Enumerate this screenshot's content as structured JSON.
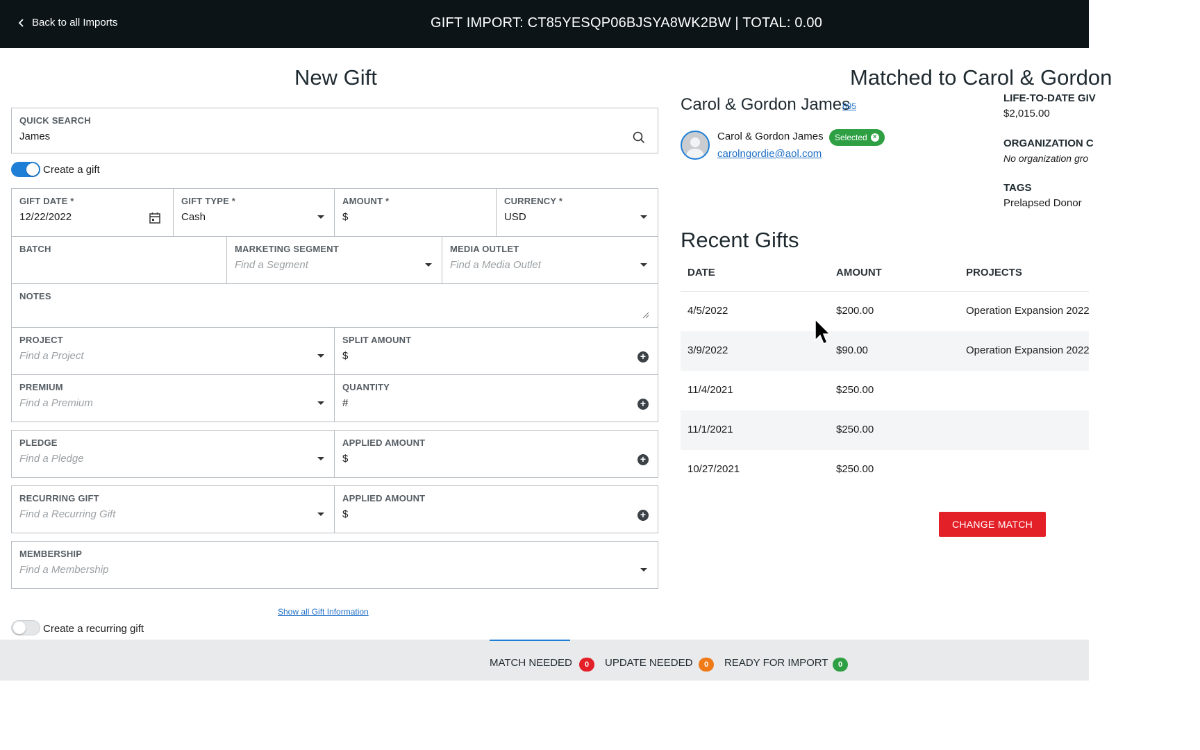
{
  "header": {
    "back_label": "Back to all Imports",
    "title": "GIFT IMPORT: CT85YESQP06BJSYA8WK2BW | TOTAL: 0.00"
  },
  "left": {
    "heading": "New Gift",
    "quick_search": {
      "label": "QUICK SEARCH",
      "value": "James"
    },
    "create_gift_toggle": "Create a gift",
    "gift_date": {
      "label": "GIFT DATE *",
      "value": "12/22/2022"
    },
    "gift_type": {
      "label": "GIFT TYPE *",
      "value": "Cash"
    },
    "amount": {
      "label": "AMOUNT *",
      "prefix": "$"
    },
    "currency": {
      "label": "CURRENCY *",
      "value": "USD"
    },
    "batch": {
      "label": "BATCH"
    },
    "marketing_segment": {
      "label": "MARKETING SEGMENT",
      "placeholder": "Find a Segment"
    },
    "media_outlet": {
      "label": "MEDIA OUTLET",
      "placeholder": "Find a Media Outlet"
    },
    "notes": {
      "label": "NOTES"
    },
    "project": {
      "label": "PROJECT",
      "placeholder": "Find a Project"
    },
    "split_amount": {
      "label": "SPLIT AMOUNT",
      "prefix": "$"
    },
    "premium": {
      "label": "PREMIUM",
      "placeholder": "Find a Premium"
    },
    "quantity": {
      "label": "QUANTITY",
      "prefix": "#"
    },
    "pledge": {
      "label": "PLEDGE",
      "placeholder": "Find a Pledge"
    },
    "pledge_applied": {
      "label": "APPLIED AMOUNT",
      "prefix": "$"
    },
    "recurring_gift": {
      "label": "RECURRING GIFT",
      "placeholder": "Find a Recurring Gift"
    },
    "recurring_applied": {
      "label": "APPLIED AMOUNT",
      "prefix": "$"
    },
    "membership": {
      "label": "MEMBERSHIP",
      "placeholder": "Find a Membership"
    },
    "show_all_link": "Show all Gift Information",
    "recurring_toggle": "Create a recurring gift"
  },
  "right": {
    "heading": "Matched to Carol & Gordon",
    "donor_name": "Carol & Gordon James",
    "donor_id": "695",
    "contact_name": "Carol & Gordon James",
    "selected_badge": "Selected",
    "email": "carolngordie@aol.com",
    "lifetime_label": "LIFE-TO-DATE GIV",
    "lifetime_value": "$2,015.00",
    "org_label": "ORGANIZATION C",
    "org_value": "No organization gro",
    "tags_label": "TAGS",
    "tags_value": "Prelapsed Donor",
    "recent_heading": "Recent Gifts",
    "columns": [
      "DATE",
      "AMOUNT",
      "PROJECTS"
    ],
    "gifts": [
      {
        "date": "4/5/2022",
        "amount": "$200.00",
        "project": "Operation Expansion 2022"
      },
      {
        "date": "3/9/2022",
        "amount": "$90.00",
        "project": "Operation Expansion 2022"
      },
      {
        "date": "11/4/2021",
        "amount": "$250.00",
        "project": ""
      },
      {
        "date": "11/1/2021",
        "amount": "$250.00",
        "project": ""
      },
      {
        "date": "10/27/2021",
        "amount": "$250.00",
        "project": ""
      }
    ],
    "change_match": "CHANGE MATCH"
  },
  "footer": {
    "tabs": [
      {
        "label": "MATCH NEEDED",
        "count": "0",
        "color": "#e32028"
      },
      {
        "label": "UPDATE NEEDED",
        "count": "0",
        "color": "#f07a18"
      },
      {
        "label": "READY FOR IMPORT",
        "count": "0",
        "color": "#2ea043"
      }
    ]
  }
}
